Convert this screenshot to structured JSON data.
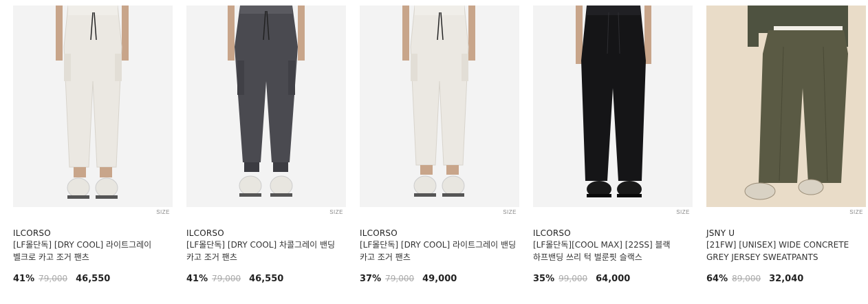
{
  "products": [
    {
      "brand": "ILCORSO",
      "title": "[LF몰단독] [DRY COOL] 라이트그레이 벨크로 카고 조거 팬츠",
      "size_label": "SIZE",
      "discount": "41%",
      "original_price": "79,000",
      "sale_price": "46,550",
      "pants_color": "#ebe8e2",
      "background": "#f3f3f3",
      "shoe_color": "#e8e6e0"
    },
    {
      "brand": "ILCORSO",
      "title": "[LF몰단독] [DRY COOL] 차콜그레이 밴딩 카고 조거 팬츠",
      "size_label": "SIZE",
      "discount": "41%",
      "original_price": "79,000",
      "sale_price": "46,550",
      "pants_color": "#4a4a50",
      "background": "#f3f3f3",
      "shoe_color": "#e8e6e0"
    },
    {
      "brand": "ILCORSO",
      "title": "[LF몰단독] [DRY COOL] 라이트그레이 밴딩 카고 조거 팬츠",
      "size_label": "SIZE",
      "discount": "37%",
      "original_price": "79,000",
      "sale_price": "49,000",
      "pants_color": "#ebe8e2",
      "background": "#f3f3f3",
      "shoe_color": "#e8e6e0"
    },
    {
      "brand": "ILCORSO",
      "title": "[LF몰단독][COOL MAX] [22SS] 블랙 하프밴딩 쓰리 턱 벌룬핏 슬랙스",
      "size_label": "SIZE",
      "discount": "35%",
      "original_price": "99,000",
      "sale_price": "64,000",
      "pants_color": "#151517",
      "background": "#f3f3f3",
      "shoe_color": "#1a1a1a"
    },
    {
      "brand": "JSNY U",
      "title": "[21FW] [UNISEX] WIDE CONCRETE GREY JERSEY SWEATPANTS",
      "size_label": "SIZE",
      "discount": "64%",
      "original_price": "89,000",
      "sale_price": "32,040",
      "pants_color": "#5a5a44",
      "background": "#e9dcc8",
      "shoe_color": "#d9d2c4"
    }
  ]
}
